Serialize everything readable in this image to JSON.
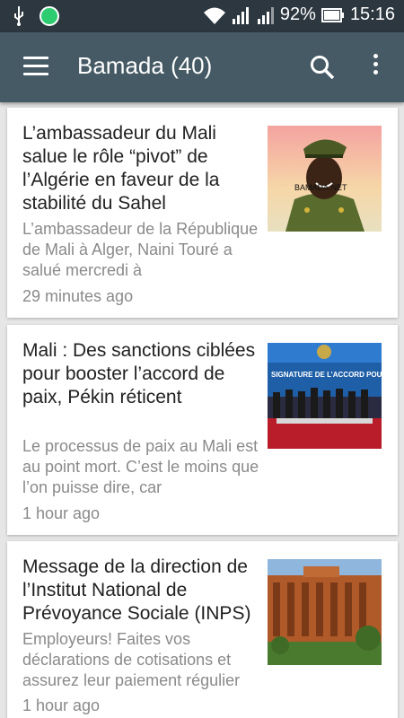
{
  "status_bar": {
    "battery": "92%",
    "time": "15:16",
    "icons": [
      "usb-icon",
      "app-notification-icon",
      "wifi-icon",
      "signal-icon",
      "signal-icon-2",
      "battery-icon"
    ]
  },
  "app_bar": {
    "title": "Bamada (40)",
    "icons": [
      "menu-icon",
      "search-icon",
      "more-vert-icon"
    ],
    "color": "#455a64"
  },
  "articles": [
    {
      "title": "L’ambassadeur du Mali salue le rôle “pivot” de l’Algérie en faveur de la stabilité du Sahel",
      "snippet": "L’ambassadeur de la République de Mali à Alger, Naini Touré a salué mercredi à",
      "time": "29 minutes ago",
      "thumb_watermark": "BAMADA.NET"
    },
    {
      "title": "Mali : Des sanctions ciblées pour booster l’accord de paix, Pékin réticent",
      "snippet": "Le processus de paix au Mali est au point mort. C’est le moins que l’on puisse dire, car",
      "time": "1 hour ago",
      "thumb_banner": "SIGNATURE DE L’ACCORD POUR LA PAIX"
    },
    {
      "title": "Message de la direction de l’Institut National de Prévoyance Sociale (INPS)",
      "snippet": "Employeurs! Faites vos déclarations de cotisations et assurez leur paiement régulier",
      "time": "1 hour ago"
    }
  ]
}
